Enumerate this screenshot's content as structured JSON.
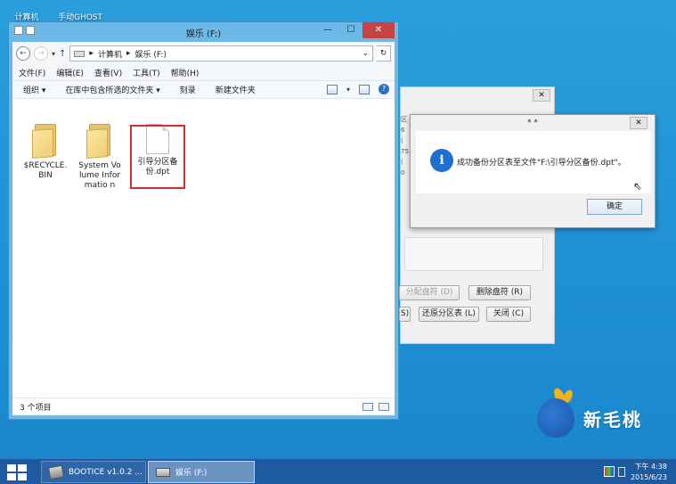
{
  "desktop": {
    "icons": [
      {
        "label": "计算机"
      },
      {
        "label": "手动GHOST"
      }
    ],
    "logo_text": "新毛桃"
  },
  "explorer": {
    "title": "娱乐 (F:)",
    "address": {
      "computer": "计算机",
      "drive": "娱乐 (F:)"
    },
    "menu": [
      "文件(F)",
      "编辑(E)",
      "查看(V)",
      "工具(T)",
      "帮助(H)"
    ],
    "commands": [
      "组织 ▾",
      "在库中包含所选的文件夹 ▾",
      "刻录",
      "新建文件夹"
    ],
    "files": [
      {
        "name": "$RECYCLE.\nBIN",
        "kind": "folder"
      },
      {
        "name": "System Volume Informatio n",
        "kind": "folder"
      },
      {
        "name": "引导分区备份.dpt",
        "kind": "document"
      }
    ],
    "status": "3 个项目"
  },
  "bootice": {
    "left_fragments": [
      "区",
      "6",
      "(",
      "75",
      "(",
      "0"
    ],
    "buttons": {
      "assign_letter": "分配盘符 (D)",
      "delete_letter": "删除盘符 (R)",
      "s_suffix": "S)",
      "restore": "还原分区表 (L)",
      "close": "关闭 (C)"
    }
  },
  "dialog": {
    "title": "* *",
    "message": "成功备份分区表至文件\"F:\\引导分区备份.dpt\"。",
    "ok": "确定"
  },
  "taskbar": {
    "items": [
      "BOOTICE v1.0.2 ...",
      "娱乐 (F:)"
    ],
    "time": "下午 4:38",
    "date": "2015/6/23"
  }
}
